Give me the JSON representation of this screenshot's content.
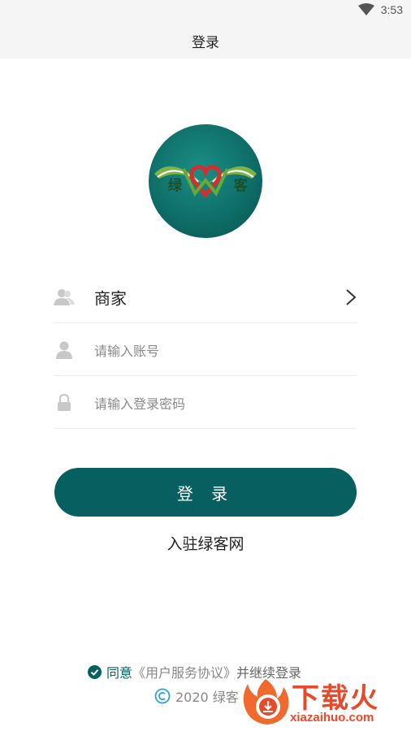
{
  "status_bar": {
    "time": "3:53"
  },
  "header": {
    "title": "登录"
  },
  "logo": {
    "left_text": "绿",
    "right_text": "客"
  },
  "form": {
    "role_label": "商家",
    "account_placeholder": "请输入账号",
    "password_placeholder": "请输入登录密码",
    "login_button": "登 录",
    "join_link": "入驻绿客网"
  },
  "footer": {
    "agree_prefix": "同意",
    "agree_link": "《用户服务协议》",
    "agree_suffix": "并继续登录",
    "copyright": "2020 绿客"
  },
  "watermark": {
    "title": "下载火",
    "domain": "xiazaihuo.com"
  },
  "colors": {
    "primary": "#075f5f",
    "logo_bg": "#0e7b74",
    "logo_leaf": "#7cb342",
    "heart": "#d32f2f",
    "watermark": "#e8492a"
  }
}
